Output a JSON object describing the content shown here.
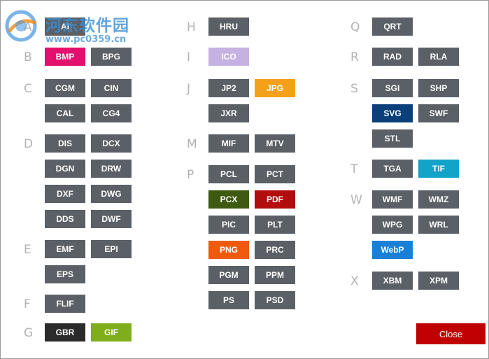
{
  "colors": {
    "tile_default": "#5a6066",
    "close_button": "#c00000"
  },
  "groups": [
    {
      "letter": "A",
      "formats": [
        {
          "label": "AI",
          "color": "#5a6066"
        }
      ]
    },
    {
      "letter": "B",
      "formats": [
        {
          "label": "BMP",
          "color": "#e3106e"
        },
        {
          "label": "BPG",
          "color": "#5a6066"
        }
      ]
    },
    {
      "letter": "C",
      "formats": [
        {
          "label": "CGM",
          "color": "#5a6066"
        },
        {
          "label": "CIN",
          "color": "#5a6066"
        },
        {
          "label": "CAL",
          "color": "#5a6066"
        },
        {
          "label": "CG4",
          "color": "#5a6066"
        }
      ]
    },
    {
      "letter": "D",
      "formats": [
        {
          "label": "DIS",
          "color": "#5a6066"
        },
        {
          "label": "DCX",
          "color": "#5a6066"
        },
        {
          "label": "DGN",
          "color": "#5a6066"
        },
        {
          "label": "DRW",
          "color": "#5a6066"
        },
        {
          "label": "DXF",
          "color": "#5a6066"
        },
        {
          "label": "DWG",
          "color": "#5a6066"
        },
        {
          "label": "DDS",
          "color": "#5a6066"
        },
        {
          "label": "DWF",
          "color": "#5a6066"
        }
      ]
    },
    {
      "letter": "E",
      "formats": [
        {
          "label": "EMF",
          "color": "#5a6066"
        },
        {
          "label": "EPI",
          "color": "#5a6066"
        },
        {
          "label": "EPS",
          "color": "#5a6066"
        }
      ]
    },
    {
      "letter": "F",
      "formats": [
        {
          "label": "FLIF",
          "color": "#5a6066"
        }
      ]
    },
    {
      "letter": "G",
      "formats": [
        {
          "label": "GBR",
          "color": "#2b2b2b"
        },
        {
          "label": "GIF",
          "color": "#7fae1c"
        }
      ]
    },
    {
      "letter": "H",
      "formats": [
        {
          "label": "HRU",
          "color": "#5a6066"
        }
      ]
    },
    {
      "letter": "I",
      "formats": [
        {
          "label": "ICO",
          "color": "#c5b2e2"
        }
      ]
    },
    {
      "letter": "J",
      "formats": [
        {
          "label": "JP2",
          "color": "#5a6066"
        },
        {
          "label": "JPG",
          "color": "#f5a019"
        },
        {
          "label": "JXR",
          "color": "#5a6066"
        }
      ]
    },
    {
      "letter": "M",
      "formats": [
        {
          "label": "MIF",
          "color": "#5a6066"
        },
        {
          "label": "MTV",
          "color": "#5a6066"
        }
      ]
    },
    {
      "letter": "P",
      "formats": [
        {
          "label": "PCL",
          "color": "#5a6066"
        },
        {
          "label": "PCT",
          "color": "#5a6066"
        },
        {
          "label": "PCX",
          "color": "#3d5a10"
        },
        {
          "label": "PDF",
          "color": "#b30c0c"
        },
        {
          "label": "PIC",
          "color": "#5a6066"
        },
        {
          "label": "PLT",
          "color": "#5a6066"
        },
        {
          "label": "PNG",
          "color": "#f05a0e"
        },
        {
          "label": "PRC",
          "color": "#5a6066"
        },
        {
          "label": "PGM",
          "color": "#5a6066"
        },
        {
          "label": "PPM",
          "color": "#5a6066"
        },
        {
          "label": "PS",
          "color": "#5a6066"
        },
        {
          "label": "PSD",
          "color": "#5a6066"
        }
      ]
    },
    {
      "letter": "Q",
      "formats": [
        {
          "label": "QRT",
          "color": "#5a6066"
        }
      ]
    },
    {
      "letter": "R",
      "formats": [
        {
          "label": "RAD",
          "color": "#5a6066"
        },
        {
          "label": "RLA",
          "color": "#5a6066"
        }
      ]
    },
    {
      "letter": "S",
      "formats": [
        {
          "label": "SGI",
          "color": "#5a6066"
        },
        {
          "label": "SHP",
          "color": "#5a6066"
        },
        {
          "label": "SVG",
          "color": "#0a3f7a"
        },
        {
          "label": "SWF",
          "color": "#5a6066"
        },
        {
          "label": "STL",
          "color": "#5a6066"
        }
      ]
    },
    {
      "letter": "T",
      "formats": [
        {
          "label": "TGA",
          "color": "#5a6066"
        },
        {
          "label": "TIF",
          "color": "#12a3c9"
        }
      ]
    },
    {
      "letter": "W",
      "formats": [
        {
          "label": "WMF",
          "color": "#5a6066"
        },
        {
          "label": "WMZ",
          "color": "#5a6066"
        },
        {
          "label": "WPG",
          "color": "#5a6066"
        },
        {
          "label": "WRL",
          "color": "#5a6066"
        },
        {
          "label": "WebP",
          "color": "#1a7fd6"
        }
      ]
    },
    {
      "letter": "X",
      "formats": [
        {
          "label": "XBM",
          "color": "#5a6066"
        },
        {
          "label": "XPM",
          "color": "#5a6066"
        }
      ]
    }
  ],
  "close_label": "Close",
  "watermark": {
    "title": "河东软件园",
    "url": "www.pc0359.cn"
  }
}
